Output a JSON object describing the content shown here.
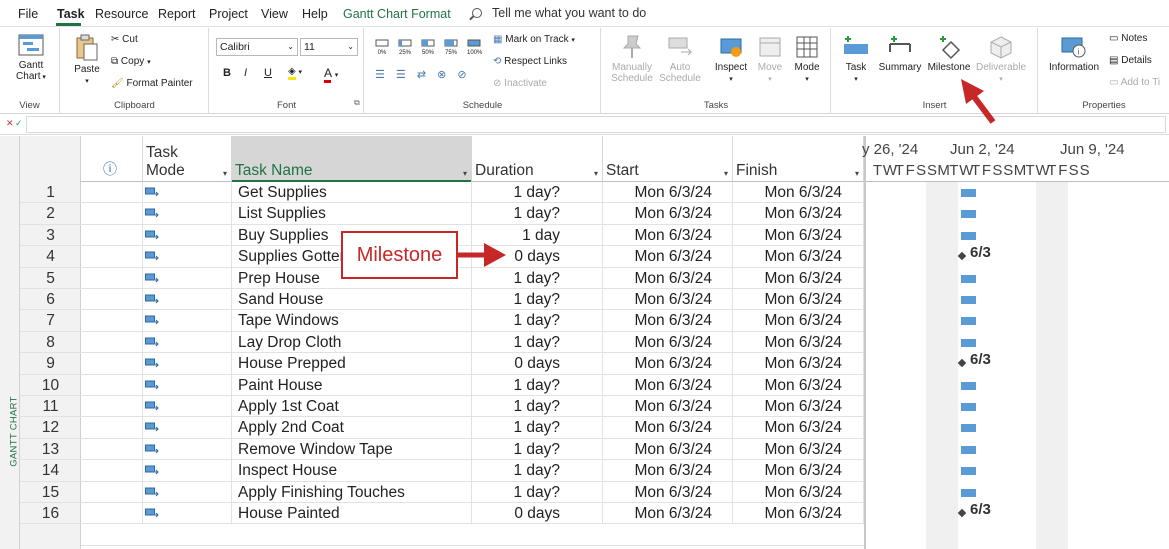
{
  "menu": {
    "items": [
      {
        "label": "File"
      },
      {
        "label": "Task"
      },
      {
        "label": "Resource"
      },
      {
        "label": "Report"
      },
      {
        "label": "Project"
      },
      {
        "label": "View"
      },
      {
        "label": "Help"
      },
      {
        "label": "Gantt Chart Format"
      }
    ],
    "tell_me": "Tell me what you want to do"
  },
  "ribbon": {
    "view": {
      "label": "View",
      "gantt": "Gantt",
      "gantt2": "Chart"
    },
    "clipboard": {
      "label": "Clipboard",
      "paste": "Paste",
      "cut": "Cut",
      "copy": "Copy",
      "format_painter": "Format Painter"
    },
    "font": {
      "label": "Font",
      "family": "Calibri",
      "size": "11",
      "bold": "B",
      "italic": "I",
      "underline": "U",
      "font_color": "A"
    },
    "schedule": {
      "label": "Schedule",
      "mark_on_track": "Mark on Track",
      "respect_links": "Respect Links",
      "inactivate": "Inactivate",
      "pct": [
        "0%",
        "25%",
        "50%",
        "75%",
        "100%"
      ]
    },
    "tasks": {
      "label": "Tasks",
      "manually": "Manually",
      "manually2": "Schedule",
      "auto": "Auto",
      "auto2": "Schedule",
      "inspect": "Inspect",
      "move": "Move",
      "mode": "Mode"
    },
    "insert": {
      "label": "Insert",
      "task": "Task",
      "summary": "Summary",
      "milestone": "Milestone",
      "deliverable": "Deliverable"
    },
    "properties": {
      "label": "Properties",
      "information": "Information",
      "notes": "Notes",
      "details": "Details",
      "add_to_timeline": "Add to Ti"
    }
  },
  "sidebar_label": "GANTT CHART",
  "columns": {
    "info": "ⓘ",
    "mode1": "Task",
    "mode2": "Mode",
    "name": "Task Name",
    "duration": "Duration",
    "start": "Start",
    "finish": "Finish"
  },
  "tasks": [
    {
      "id": "1",
      "name": "Get Supplies",
      "duration": "1 day?",
      "start": "Mon 6/3/24",
      "finish": "Mon 6/3/24"
    },
    {
      "id": "2",
      "name": "List Supplies",
      "duration": "1 day?",
      "start": "Mon 6/3/24",
      "finish": "Mon 6/3/24"
    },
    {
      "id": "3",
      "name": "Buy Supplies",
      "duration": "1 day",
      "start": "Mon 6/3/24",
      "finish": "Mon 6/3/24"
    },
    {
      "id": "4",
      "name": "Supplies Gotten",
      "duration": "0 days",
      "start": "Mon 6/3/24",
      "finish": "Mon 6/3/24"
    },
    {
      "id": "5",
      "name": "Prep House",
      "duration": "1 day?",
      "start": "Mon 6/3/24",
      "finish": "Mon 6/3/24"
    },
    {
      "id": "6",
      "name": "Sand House",
      "duration": "1 day?",
      "start": "Mon 6/3/24",
      "finish": "Mon 6/3/24"
    },
    {
      "id": "7",
      "name": "Tape Windows",
      "duration": "1 day?",
      "start": "Mon 6/3/24",
      "finish": "Mon 6/3/24"
    },
    {
      "id": "8",
      "name": "Lay Drop Cloth",
      "duration": "1 day?",
      "start": "Mon 6/3/24",
      "finish": "Mon 6/3/24"
    },
    {
      "id": "9",
      "name": "House Prepped",
      "duration": "0 days",
      "start": "Mon 6/3/24",
      "finish": "Mon 6/3/24"
    },
    {
      "id": "10",
      "name": "Paint House",
      "duration": "1 day?",
      "start": "Mon 6/3/24",
      "finish": "Mon 6/3/24"
    },
    {
      "id": "11",
      "name": "Apply 1st Coat",
      "duration": "1 day?",
      "start": "Mon 6/3/24",
      "finish": "Mon 6/3/24"
    },
    {
      "id": "12",
      "name": "Apply 2nd Coat",
      "duration": "1 day?",
      "start": "Mon 6/3/24",
      "finish": "Mon 6/3/24"
    },
    {
      "id": "13",
      "name": "Remove Window Tape",
      "duration": "1 day?",
      "start": "Mon 6/3/24",
      "finish": "Mon 6/3/24"
    },
    {
      "id": "14",
      "name": "Inspect House",
      "duration": "1 day?",
      "start": "Mon 6/3/24",
      "finish": "Mon 6/3/24"
    },
    {
      "id": "15",
      "name": "Apply Finishing Touches",
      "duration": "1 day?",
      "start": "Mon 6/3/24",
      "finish": "Mon 6/3/24"
    },
    {
      "id": "16",
      "name": "House Painted",
      "duration": "0 days",
      "start": "Mon 6/3/24",
      "finish": "Mon 6/3/24"
    }
  ],
  "gantt": {
    "weeks": [
      "y 26, '24",
      "Jun 2, '24",
      "Jun 9, '24"
    ],
    "days": [
      "T",
      "W",
      "T",
      "F",
      "S",
      "S",
      "M",
      "T",
      "W",
      "T",
      "F",
      "S",
      "S",
      "M",
      "T",
      "W",
      "T",
      "F",
      "S",
      "S"
    ],
    "milestone_label": "6/3",
    "bar_color": "#5b9bd5"
  },
  "callout": {
    "text": "Milestone",
    "color": "#c62828"
  },
  "colors": {
    "accent": "#217346"
  }
}
